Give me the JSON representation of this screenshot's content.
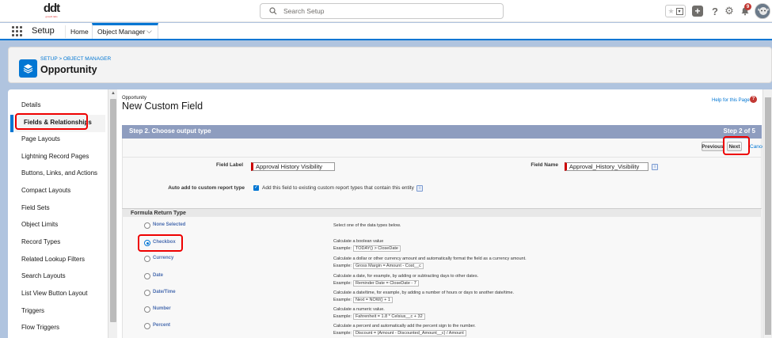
{
  "header": {
    "logo_text": "ddt",
    "logo_tagline": "growth labs",
    "search_placeholder": "Search Setup",
    "notification_count": "9"
  },
  "nav": {
    "app_name": "Setup",
    "home": "Home",
    "object_manager": "Object Manager"
  },
  "page_header": {
    "breadcrumb": "SETUP > OBJECT MANAGER",
    "title": "Opportunity"
  },
  "sidebar": {
    "items": [
      "Details",
      "Fields & Relationships",
      "Page Layouts",
      "Lightning Record Pages",
      "Buttons, Links, and Actions",
      "Compact Layouts",
      "Field Sets",
      "Object Limits",
      "Record Types",
      "Related Lookup Filters",
      "Search Layouts",
      "List View Button Layout",
      "Triggers",
      "Flow Triggers"
    ],
    "selected_index": 1
  },
  "content": {
    "object": "Opportunity",
    "title": "New Custom Field",
    "help_link": "Help for this Page",
    "step_label": "Step 2. Choose output type",
    "step_count": "Step 2 of 5",
    "buttons": {
      "previous": "Previous",
      "next": "Next",
      "cancel": "Cancel"
    },
    "field_label_label": "Field Label",
    "field_label_value": "Approval History Visibility",
    "field_name_label": "Field Name",
    "field_name_value": "Approval_History_Visibility",
    "info_glyph": "i",
    "auto_add_label": "Auto add to custom report type",
    "auto_add_text": "Add this field to existing custom report types that contain this entity",
    "section_title": "Formula Return Type",
    "options": [
      {
        "label": "None Selected",
        "desc": "Select one of the data types below.",
        "example": ""
      },
      {
        "label": "Checkbox",
        "desc": "Calculate a boolean value",
        "example": "TODAY() > CloseDate"
      },
      {
        "label": "Currency",
        "desc": "Calculate a dollar or other currency amount and automatically format the field as a currency amount.",
        "example": "Gross Margin = Amount - Cost__c"
      },
      {
        "label": "Date",
        "desc": "Calculate a date, for example, by adding or subtracting days to other dates.",
        "example": "Reminder Date = CloseDate - 7"
      },
      {
        "label": "Date/Time",
        "desc": "Calculate a date/time, for example, by adding a number of hours or days to another date/time.",
        "example": "Next = NOW() + 1"
      },
      {
        "label": "Number",
        "desc": "Calculate a numeric value.",
        "example": "Fahrenheit = 1.8 * Celsius__c + 32"
      },
      {
        "label": "Percent",
        "desc": "Calculate a percent and automatically add the percent sign to the number.",
        "example": "Discount = (Amount - Discounted_Amount__c) / Amount"
      }
    ],
    "example_prefix": "Example:",
    "selected_option": 1
  }
}
